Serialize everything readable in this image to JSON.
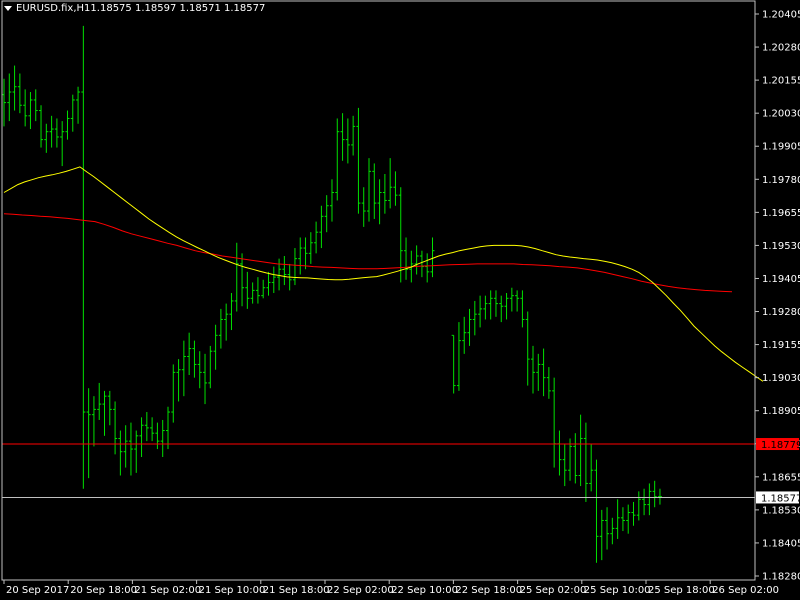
{
  "header": {
    "symbol": "EURUSD.fix,H1",
    "ohlc": "1.18575 1.18597 1.18571 1.18577"
  },
  "colors": {
    "background": "#000000",
    "axis": "#c0c0c0",
    "bars": "#00e000",
    "fast_ma": "#ffff00",
    "slow_ma": "#ff0000",
    "level_line": "#ff0000",
    "bid_line": "#c0c0c0",
    "level_label_bg": "#ff0000",
    "bid_label_bg": "#ffffff"
  },
  "markers": {
    "level": {
      "value": 1.18779,
      "label": "1.18779"
    },
    "bid": {
      "value": 1.18577,
      "label": "1.18577"
    }
  },
  "chart_data": {
    "type": "ohlc",
    "symbol": "EURUSD.fix",
    "timeframe": "H1",
    "ylim": [
      1.1828,
      1.2046
    ],
    "yticks": [
      "1.20405",
      "1.20280",
      "1.20155",
      "1.20030",
      "1.19905",
      "1.19780",
      "1.19655",
      "1.19530",
      "1.19405",
      "1.19280",
      "1.19155",
      "1.19030",
      "1.18905",
      "1.18780",
      "1.18655",
      "1.18530",
      "1.18405",
      "1.18280"
    ],
    "xticks": [
      "20 Sep 2017",
      "20 Sep 18:00",
      "21 Sep 02:00",
      "21 Sep 10:00",
      "21 Sep 18:00",
      "22 Sep 02:00",
      "22 Sep 10:00",
      "22 Sep 18:00",
      "25 Sep 02:00",
      "25 Sep 10:00",
      "25 Sep 18:00",
      "26 Sep 02:00"
    ],
    "series_bars": [
      [
        1.201,
        1.2016,
        1.1998,
        1.2007
      ],
      [
        1.2007,
        1.2018,
        1.2,
        1.2011
      ],
      [
        1.2011,
        1.2021,
        1.2004,
        1.2013
      ],
      [
        1.2013,
        1.2018,
        1.2003,
        1.2006
      ],
      [
        1.2006,
        1.2012,
        1.1998,
        1.2002
      ],
      [
        1.2002,
        1.2011,
        1.1997,
        1.2008
      ],
      [
        1.2008,
        1.2012,
        1.2,
        1.2004
      ],
      [
        1.2004,
        1.2006,
        1.199,
        1.1993
      ],
      [
        1.1993,
        1.1999,
        1.1988,
        1.1996
      ],
      [
        1.1996,
        1.2002,
        1.199,
        1.1997
      ],
      [
        1.1997,
        1.2001,
        1.199,
        1.1994
      ],
      [
        1.1994,
        1.2,
        1.1983,
        1.1996
      ],
      [
        1.1996,
        1.2004,
        1.1993,
        1.2001
      ],
      [
        1.2001,
        1.201,
        1.1996,
        1.2008
      ],
      [
        1.2008,
        1.2013,
        1.1999,
        1.2011
      ],
      [
        1.2011,
        1.2036,
        1.1861,
        1.189
      ],
      [
        1.189,
        1.1899,
        1.1865,
        1.1889
      ],
      [
        1.1889,
        1.1896,
        1.1877,
        1.1891
      ],
      [
        1.1891,
        1.1901,
        1.1887,
        1.1893
      ],
      [
        1.1893,
        1.1898,
        1.1881,
        1.1896
      ],
      [
        1.1896,
        1.1898,
        1.1885,
        1.1891
      ],
      [
        1.1891,
        1.1894,
        1.1874,
        1.188
      ],
      [
        1.188,
        1.1883,
        1.1866,
        1.1875
      ],
      [
        1.1875,
        1.1885,
        1.1869,
        1.1879
      ],
      [
        1.1879,
        1.1886,
        1.1866,
        1.1876
      ],
      [
        1.1876,
        1.1883,
        1.1867,
        1.1881
      ],
      [
        1.1881,
        1.1888,
        1.1873,
        1.1885
      ],
      [
        1.1885,
        1.189,
        1.1879,
        1.1884
      ],
      [
        1.1884,
        1.1888,
        1.1879,
        1.1882
      ],
      [
        1.1882,
        1.1886,
        1.1876,
        1.1879
      ],
      [
        1.1879,
        1.1887,
        1.1873,
        1.1883
      ],
      [
        1.1883,
        1.1892,
        1.1876,
        1.189
      ],
      [
        1.189,
        1.1908,
        1.1886,
        1.1905
      ],
      [
        1.1905,
        1.191,
        1.1894,
        1.1906
      ],
      [
        1.1906,
        1.1917,
        1.1896,
        1.1911
      ],
      [
        1.1911,
        1.192,
        1.1904,
        1.1914
      ],
      [
        1.1914,
        1.1917,
        1.1903,
        1.1908
      ],
      [
        1.1908,
        1.1913,
        1.1899,
        1.1905
      ],
      [
        1.1905,
        1.1912,
        1.1893,
        1.1901
      ],
      [
        1.1901,
        1.1915,
        1.1899,
        1.1913
      ],
      [
        1.1913,
        1.1923,
        1.1906,
        1.1919
      ],
      [
        1.1919,
        1.1929,
        1.1914,
        1.1925
      ],
      [
        1.1925,
        1.1931,
        1.1917,
        1.1927
      ],
      [
        1.1927,
        1.1935,
        1.1921,
        1.1932
      ],
      [
        1.1932,
        1.1954,
        1.1928,
        1.1946
      ],
      [
        1.1946,
        1.195,
        1.193,
        1.1937
      ],
      [
        1.1937,
        1.1943,
        1.1929,
        1.1933
      ],
      [
        1.1933,
        1.1939,
        1.1931,
        1.1936
      ],
      [
        1.1936,
        1.1941,
        1.1931,
        1.1934
      ],
      [
        1.1934,
        1.194,
        1.1933,
        1.1937
      ],
      [
        1.1937,
        1.1943,
        1.1934,
        1.1939
      ],
      [
        1.1939,
        1.1945,
        1.1935,
        1.1941
      ],
      [
        1.1941,
        1.1948,
        1.1936,
        1.1944
      ],
      [
        1.1944,
        1.1949,
        1.1938,
        1.1942
      ],
      [
        1.1942,
        1.1946,
        1.1936,
        1.194
      ],
      [
        1.194,
        1.1952,
        1.1938,
        1.1948
      ],
      [
        1.1948,
        1.1956,
        1.1942,
        1.1952
      ],
      [
        1.1952,
        1.1956,
        1.1944,
        1.195
      ],
      [
        1.195,
        1.1958,
        1.1946,
        1.1954
      ],
      [
        1.1954,
        1.1962,
        1.195,
        1.1958
      ],
      [
        1.1958,
        1.1968,
        1.1952,
        1.1964
      ],
      [
        1.1964,
        1.1972,
        1.1958,
        1.1968
      ],
      [
        1.1968,
        1.1978,
        1.1962,
        1.1973
      ],
      [
        1.1973,
        1.2001,
        1.197,
        1.1996
      ],
      [
        1.1996,
        1.2003,
        1.1985,
        1.1993
      ],
      [
        1.1993,
        1.2001,
        1.1984,
        1.1991
      ],
      [
        1.1991,
        1.2002,
        1.1987,
        1.1998
      ],
      [
        1.1998,
        1.2005,
        1.1965,
        1.1969
      ],
      [
        1.1969,
        1.1975,
        1.196,
        1.1966
      ],
      [
        1.1966,
        1.1986,
        1.1962,
        1.1981
      ],
      [
        1.1981,
        1.1984,
        1.1963,
        1.1969
      ],
      [
        1.1969,
        1.1978,
        1.1961,
        1.1973
      ],
      [
        1.1973,
        1.198,
        1.1965,
        1.197
      ],
      [
        1.197,
        1.1986,
        1.1967,
        1.1975
      ],
      [
        1.1975,
        1.1981,
        1.1968,
        1.1972
      ],
      [
        1.1972,
        1.1975,
        1.1939,
        1.1951
      ],
      [
        1.1951,
        1.1956,
        1.194,
        1.1944
      ],
      [
        1.1944,
        1.1951,
        1.1939,
        1.1946
      ],
      [
        1.1946,
        1.1953,
        1.1942,
        1.1949
      ],
      [
        1.1949,
        1.1951,
        1.1941,
        1.1945
      ],
      [
        1.1945,
        1.195,
        1.1939,
        1.1943
      ],
      [
        1.1943,
        1.1956,
        1.1941,
        1.1951
      ],
      null,
      null,
      null,
      [
        1.1919,
        1.1919,
        1.1897,
        1.19
      ],
      [
        1.19,
        1.1924,
        1.1898,
        1.1917
      ],
      [
        1.1917,
        1.1926,
        1.1912,
        1.192
      ],
      [
        1.192,
        1.1929,
        1.1915,
        1.1925
      ],
      [
        1.1925,
        1.1932,
        1.1919,
        1.1927
      ],
      [
        1.1927,
        1.1934,
        1.1922,
        1.1929
      ],
      [
        1.1929,
        1.1934,
        1.1925,
        1.1931
      ],
      [
        1.1931,
        1.1936,
        1.1925,
        1.1933
      ],
      [
        1.1933,
        1.1936,
        1.1926,
        1.1931
      ],
      [
        1.1931,
        1.1934,
        1.1924,
        1.193
      ],
      [
        1.193,
        1.1935,
        1.1925,
        1.1933
      ],
      [
        1.1933,
        1.1937,
        1.1928,
        1.1934
      ],
      [
        1.1934,
        1.1936,
        1.1928,
        1.1933
      ],
      [
        1.1933,
        1.1936,
        1.1922,
        1.1925
      ],
      [
        1.1925,
        1.1928,
        1.19,
        1.191
      ],
      [
        1.191,
        1.1915,
        1.1897,
        1.1905
      ],
      [
        1.1905,
        1.1912,
        1.1898,
        1.1908
      ],
      [
        1.1908,
        1.1914,
        1.1896,
        1.1903
      ],
      [
        1.1903,
        1.1907,
        1.1895,
        1.1898
      ],
      [
        1.1898,
        1.1903,
        1.1869,
        1.1878
      ],
      [
        1.1878,
        1.1883,
        1.1866,
        1.1872
      ],
      [
        1.1872,
        1.1878,
        1.1862,
        1.1868
      ],
      [
        1.1868,
        1.188,
        1.1864,
        1.1877
      ],
      [
        1.1877,
        1.1882,
        1.1863,
        1.1866
      ],
      [
        1.1866,
        1.1889,
        1.1862,
        1.188
      ],
      [
        1.188,
        1.1886,
        1.1856,
        1.1863
      ],
      [
        1.1863,
        1.1878,
        1.186,
        1.1868
      ],
      [
        1.1868,
        1.1872,
        1.1833,
        1.1843
      ],
      [
        1.1843,
        1.1853,
        1.1834,
        1.1849
      ],
      [
        1.1849,
        1.1854,
        1.1838,
        1.1844
      ],
      [
        1.1844,
        1.185,
        1.184,
        1.1846
      ],
      [
        1.1846,
        1.1857,
        1.1842,
        1.185
      ],
      [
        1.185,
        1.1854,
        1.1845,
        1.1849
      ],
      [
        1.1849,
        1.1855,
        1.1844,
        1.1852
      ],
      [
        1.1852,
        1.1856,
        1.1847,
        1.1851
      ],
      [
        1.1851,
        1.186,
        1.1849,
        1.1857
      ],
      [
        1.1857,
        1.1861,
        1.1851,
        1.1855
      ],
      [
        1.1855,
        1.1863,
        1.1851,
        1.186
      ],
      [
        1.186,
        1.1864,
        1.1854,
        1.1858
      ],
      [
        1.1858,
        1.1861,
        1.1855,
        1.1858
      ]
    ],
    "series_fast_ma": [
      1.1973,
      1.19745,
      1.1976,
      1.1977,
      1.19778,
      1.19786,
      1.19792,
      1.19797,
      1.19803,
      1.1981,
      1.19818,
      1.19827,
      1.19808,
      1.1979,
      1.1977,
      1.1975,
      1.1973,
      1.1971,
      1.1969,
      1.1967,
      1.1965,
      1.1963,
      1.19612,
      1.19595,
      1.19578,
      1.19562,
      1.19548,
      1.19535,
      1.19522,
      1.1951,
      1.19497,
      1.19485,
      1.19475,
      1.19465,
      1.19455,
      1.19447,
      1.1944,
      1.19433,
      1.19426,
      1.1942,
      1.19416,
      1.19411,
      1.19409,
      1.19408,
      1.19407,
      1.19405,
      1.19403,
      1.19401,
      1.194,
      1.194,
      1.19402,
      1.19405,
      1.19408,
      1.1941,
      1.19412,
      1.19418,
      1.19425,
      1.19432,
      1.1944,
      1.19448,
      1.1946,
      1.1947,
      1.1948,
      1.1949,
      1.19497,
      1.19503,
      1.1951,
      1.19515,
      1.1952,
      1.19525,
      1.19528,
      1.1953,
      1.1953,
      1.1953,
      1.1953,
      1.19528,
      1.19524,
      1.19518,
      1.1951,
      1.19503,
      1.19495,
      1.1949,
      1.19486,
      1.19483,
      1.1948,
      1.19478,
      1.19475,
      1.1947,
      1.19465,
      1.19458,
      1.1945,
      1.1944,
      1.19428,
      1.1941,
      1.1939,
      1.19365,
      1.1934,
      1.19312,
      1.19285,
      1.19255,
      1.19225,
      1.192,
      1.19175,
      1.1915,
      1.19128,
      1.19108,
      1.19088,
      1.1907,
      1.19052,
      1.19034,
      1.19016
    ],
    "series_slow_ma": [
      1.1965,
      1.19648,
      1.19645,
      1.19643,
      1.1964,
      1.19638,
      1.19635,
      1.19632,
      1.19628,
      1.19624,
      1.1962,
      1.1961,
      1.19598,
      1.19585,
      1.19574,
      1.19565,
      1.19556,
      1.19547,
      1.19538,
      1.1953,
      1.1952,
      1.1951,
      1.19503,
      1.19497,
      1.1949,
      1.19485,
      1.1948,
      1.19475,
      1.1947,
      1.19465,
      1.1946,
      1.19458,
      1.19455,
      1.19453,
      1.1945,
      1.19448,
      1.19447,
      1.19445,
      1.19443,
      1.19442,
      1.19442,
      1.19442,
      1.19443,
      1.19445,
      1.19447,
      1.1945,
      1.19452,
      1.19453,
      1.19455,
      1.19457,
      1.19458,
      1.19459,
      1.1946,
      1.1946,
      1.1946,
      1.1946,
      1.1946,
      1.19458,
      1.19457,
      1.19455,
      1.19453,
      1.1945,
      1.19448,
      1.19445,
      1.1944,
      1.19434,
      1.19428,
      1.1942,
      1.19412,
      1.19404,
      1.19395,
      1.19388,
      1.19381,
      1.19375,
      1.1937,
      1.19366,
      1.19363,
      1.1936,
      1.19358,
      1.19356,
      1.19355
    ]
  }
}
